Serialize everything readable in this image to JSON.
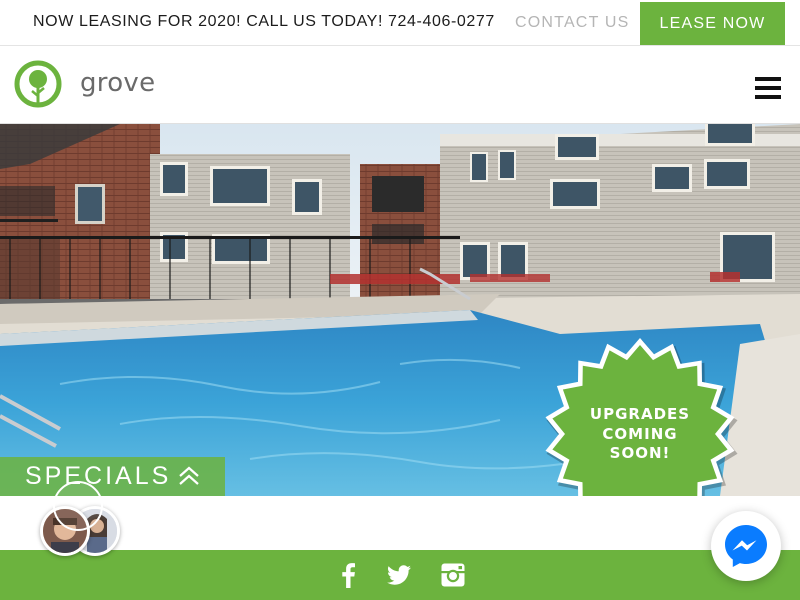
{
  "topbar": {
    "promo_text": "NOW LEASING FOR 2020! CALL US TODAY! 724-406-0277",
    "contact_label": "CONTACT US",
    "lease_label": "LEASE NOW"
  },
  "header": {
    "logo_text": "grove",
    "menu_icon": "hamburger-menu-icon"
  },
  "hero": {
    "badge_lines": [
      "UPGRADES",
      "COMING",
      "SOON!"
    ],
    "specials_label": "SPECIALS",
    "specials_icon": "double-chevron-up-icon"
  },
  "footer": {
    "social_icons": [
      "facebook-icon",
      "twitter-icon",
      "instagram-icon"
    ]
  },
  "chat": {
    "messenger_icon": "messenger-icon"
  },
  "colors": {
    "brand_green": "#6cb33e",
    "contact_gray": "#b5b5b5",
    "messenger_blue": "#0a7cff"
  }
}
